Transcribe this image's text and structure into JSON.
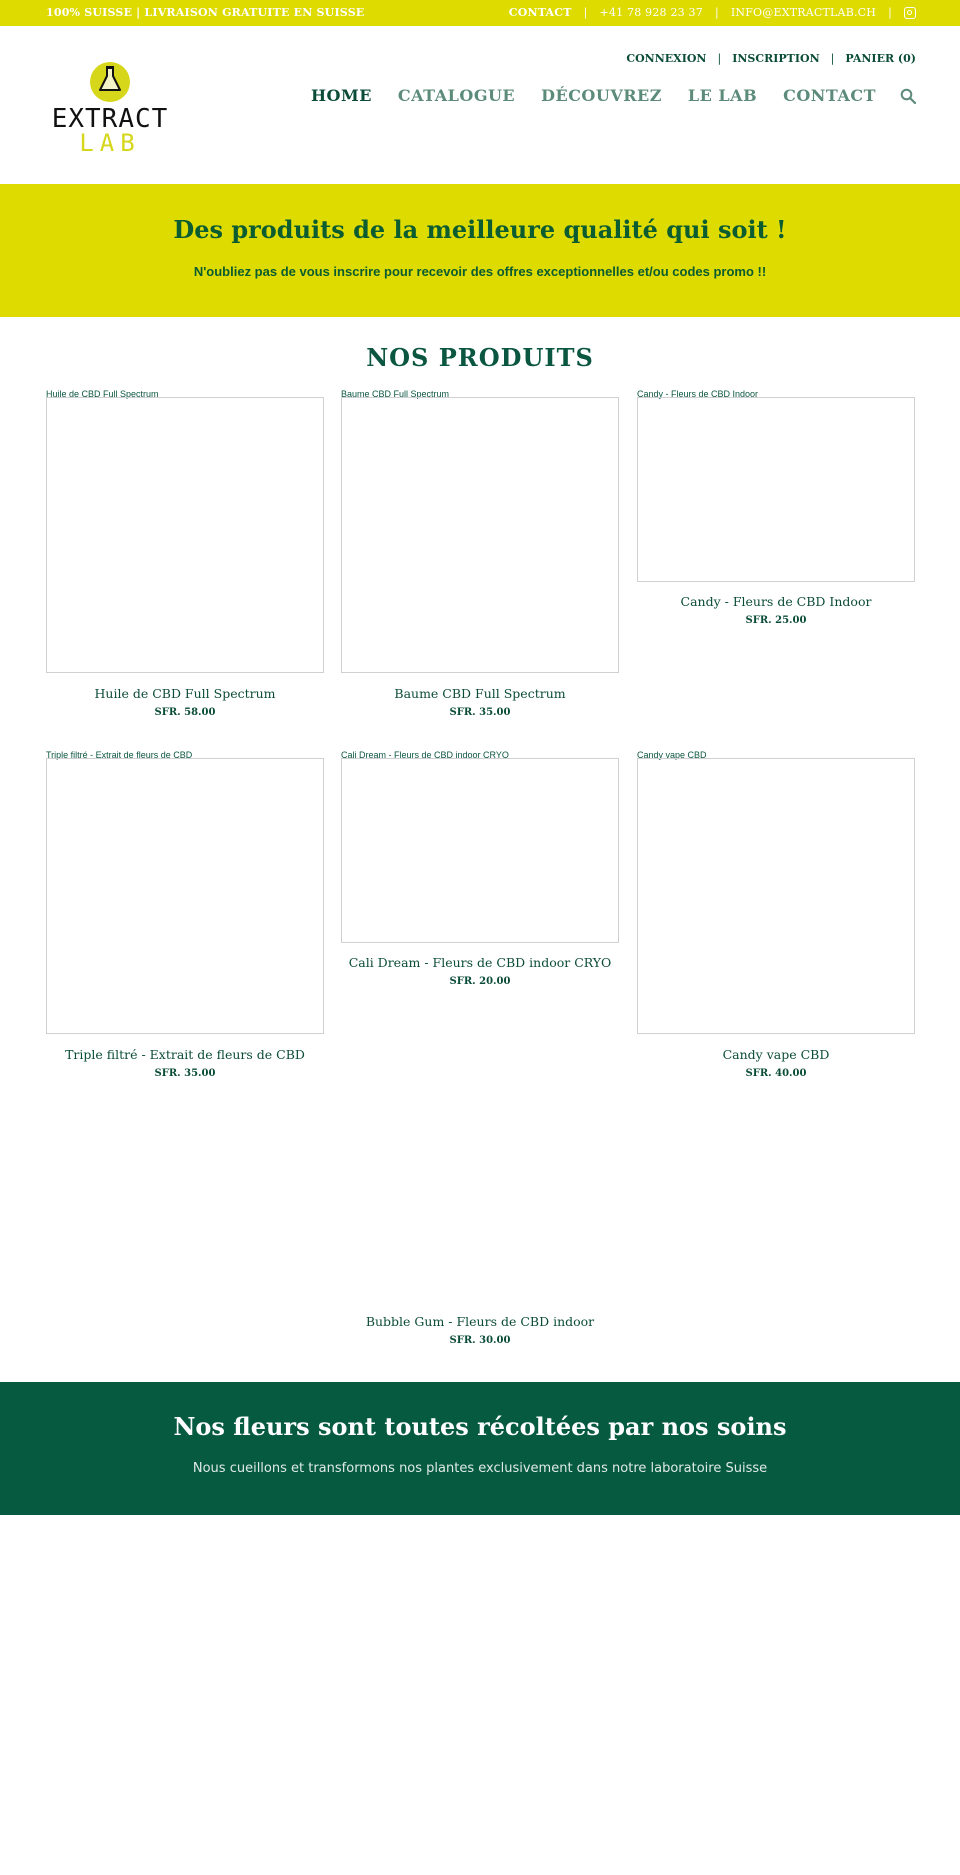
{
  "topbar": {
    "tagline": "100% SUISSE | LIVRAISON GRATUITE EN SUISSE",
    "contact_label": "CONTACT",
    "phone": "+41 78 928 23 37",
    "email": "INFO@EXTRACTLAB.CH",
    "separator": "|",
    "social_icon": "instagram-icon"
  },
  "logo": {
    "line1": "EXTRACT",
    "line2": "LAB",
    "icon": "flask-icon"
  },
  "account": {
    "login": "CONNEXION",
    "register": "INSCRIPTION",
    "cart": "PANIER (0)",
    "separator": "|"
  },
  "nav": {
    "items": [
      {
        "label": "HOME",
        "active": true
      },
      {
        "label": "CATALOGUE",
        "active": false
      },
      {
        "label": "DÉCOUVREZ",
        "active": false
      },
      {
        "label": "LE LAB",
        "active": false
      },
      {
        "label": "CONTACT",
        "active": false
      }
    ],
    "search_icon": "search-icon"
  },
  "hero": {
    "title": "Des produits de la meilleure qualité qui soit !",
    "subtitle": "N'oubliez pas de vous inscrire pour recevoir des offres exceptionnelles et/ou codes promo !!"
  },
  "products_section": {
    "title": "NOS PRODUITS",
    "items": [
      {
        "alt": "Huile de CBD Full Spectrum",
        "name": "Huile de CBD Full Spectrum",
        "price": "SFR. 58.00"
      },
      {
        "alt": "Baume CBD Full Spectrum",
        "name": "Baume CBD Full Spectrum",
        "price": "SFR. 35.00"
      },
      {
        "alt": "Candy - Fleurs de CBD Indoor",
        "name": "Candy - Fleurs de CBD Indoor",
        "price": "SFR. 25.00"
      },
      {
        "alt": "Triple filtré - Extrait de fleurs de CBD",
        "name": "Triple filtré - Extrait de fleurs de CBD",
        "price": "SFR. 35.00"
      },
      {
        "alt": "Cali Dream - Fleurs de CBD indoor CRYO",
        "name": "Cali Dream - Fleurs de CBD indoor CRYO",
        "price": "SFR. 20.00"
      },
      {
        "alt": "Candy vape CBD",
        "name": "Candy vape CBD",
        "price": "SFR. 40.00"
      },
      {
        "alt": "",
        "name": "Bubble Gum - Fleurs de CBD indoor",
        "price": "SFR. 30.00"
      }
    ]
  },
  "bottom_banner": {
    "title": "Nos fleurs sont toutes récoltées par nos soins",
    "subtitle": "Nous cueillons et transformons nos plantes exclusivement dans notre laboratoire Suisse"
  },
  "colors": {
    "brand_yellow": "#dedb00",
    "brand_green": "#055a40",
    "text_green": "#0b5640"
  }
}
